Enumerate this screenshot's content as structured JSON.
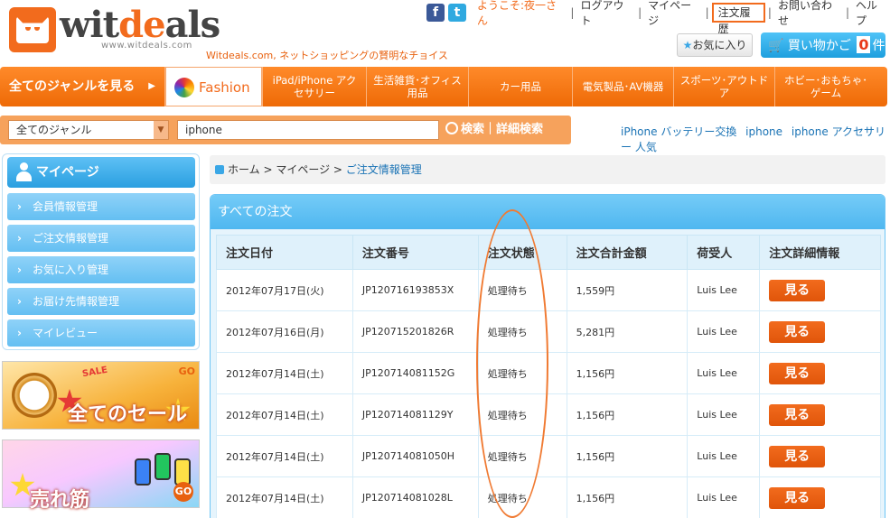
{
  "header": {
    "logo_text_1": "wit",
    "logo_text_2": "de",
    "logo_text_3": "als",
    "logo_url": "www.witdeals.com",
    "tagline": "Witdeals.com, ネットショッピングの賢明なチョイス",
    "greeting": "ようこそ:夜一さん",
    "links": [
      "ログアウト",
      "マイページ",
      "注文履歴",
      "お問い合わせ",
      "ヘルプ"
    ],
    "fav_label": "お気に入り",
    "cart_label": "買い物かご",
    "cart_count": "0",
    "cart_unit": "件"
  },
  "nav": {
    "all_label": "全てのジャンルを見る",
    "fashion": "Fashion",
    "items": [
      "iPad/iPhone アクセサリー",
      "生活雑貨･オフィス用品",
      "カー用品",
      "電気製品･AV機器",
      "スポーツ･アウトドア",
      "ホビー･おもちゃ･ゲーム"
    ]
  },
  "search": {
    "category": "全てのジャンル",
    "query": "iphone",
    "button": "検索｜詳細検索",
    "hot": [
      "iPhone バッテリー交換",
      "iphone",
      "iphone アクセサリー 人気"
    ]
  },
  "sidebar": {
    "title": "マイページ",
    "items": [
      "会員情報管理",
      "ご注文情報管理",
      "お気に入り管理",
      "お届け先情報管理",
      "マイレビュー"
    ]
  },
  "banners": {
    "b1_sale": "SALE",
    "b1_text": "全てのセール",
    "b1_go": "GO",
    "b2_text": "売れ筋",
    "b2_go": "GO"
  },
  "breadcrumb": {
    "home": "ホーム",
    "mypage": "マイページ",
    "current": "ご注文情報管理"
  },
  "orders": {
    "title": "すべての注文",
    "columns": [
      "注文日付",
      "注文番号",
      "注文状態",
      "注文合計金額",
      "荷受人",
      "注文詳細情報"
    ],
    "rows": [
      {
        "date": "2012年07月17日(火)",
        "number": "JP120716193853X",
        "status": "処理待ち",
        "total": "1,559円",
        "name": "Luis Lee",
        "btn": "見る"
      },
      {
        "date": "2012年07月16日(月)",
        "number": "JP120715201826R",
        "status": "処理待ち",
        "total": "5,281円",
        "name": "Luis Lee",
        "btn": "見る"
      },
      {
        "date": "2012年07月14日(土)",
        "number": "JP120714081152G",
        "status": "処理待ち",
        "total": "1,156円",
        "name": "Luis Lee",
        "btn": "見る"
      },
      {
        "date": "2012年07月14日(土)",
        "number": "JP120714081129Y",
        "status": "処理待ち",
        "total": "1,156円",
        "name": "Luis Lee",
        "btn": "見る"
      },
      {
        "date": "2012年07月14日(土)",
        "number": "JP120714081050H",
        "status": "処理待ち",
        "total": "1,156円",
        "name": "Luis Lee",
        "btn": "見る"
      },
      {
        "date": "2012年07月14日(土)",
        "number": "JP120714081028L",
        "status": "処理待ち",
        "total": "1,156円",
        "name": "Luis Lee",
        "btn": "見る"
      }
    ]
  },
  "colors": {
    "accent": "#f26b1d",
    "blue": "#3aa7e6"
  }
}
